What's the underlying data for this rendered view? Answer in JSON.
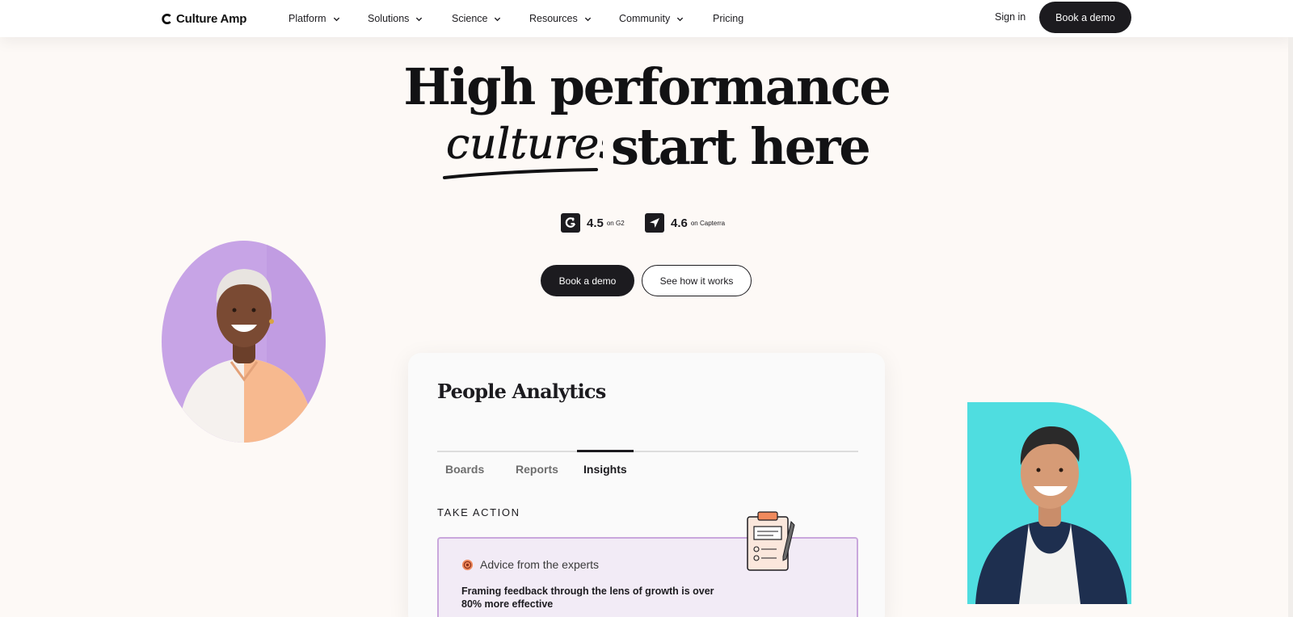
{
  "nav": {
    "logo_text": "Culture Amp",
    "items": [
      {
        "label": "Platform",
        "has_menu": true
      },
      {
        "label": "Solutions",
        "has_menu": true
      },
      {
        "label": "Science",
        "has_menu": true
      },
      {
        "label": "Resources",
        "has_menu": true
      },
      {
        "label": "Community",
        "has_menu": true
      },
      {
        "label": "Pricing",
        "has_menu": false
      }
    ],
    "sign_in": "Sign in",
    "cta": "Book a demo"
  },
  "hero": {
    "line1": "High performance",
    "script_word": "cultures",
    "line2_rest": "start here"
  },
  "ratings": [
    {
      "icon": "g2-icon",
      "score": "4.5",
      "source": "on G2"
    },
    {
      "icon": "capterra-icon",
      "score": "4.6",
      "source": "on Capterra"
    }
  ],
  "cta": {
    "primary": "Book a demo",
    "secondary": "See how it works"
  },
  "card": {
    "title": "People Analytics",
    "tabs": [
      {
        "label": "Boards",
        "active": false
      },
      {
        "label": "Reports",
        "active": false
      },
      {
        "label": "Insights",
        "active": true
      }
    ],
    "section_label": "TAKE ACTION",
    "advice": {
      "heading": "Advice from the experts",
      "body": "Framing feedback through the lens of growth is over 80% more effective"
    }
  },
  "colors": {
    "page_bg": "#fdf9f6",
    "ink": "#1c1b1f",
    "portrait_left_bg": "#c7a4e6",
    "portrait_right_bg": "#4fdde0",
    "advice_bg": "#f2ebf6",
    "advice_border": "#c9a7dc"
  }
}
